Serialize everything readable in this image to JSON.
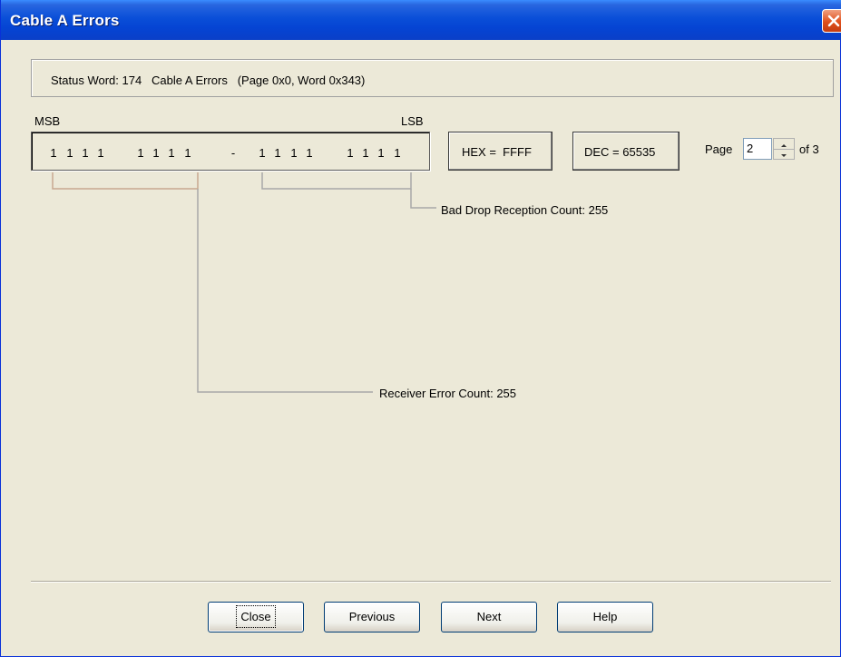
{
  "window": {
    "title": "Cable A Errors"
  },
  "status": {
    "text": "Status Word: 174   Cable A Errors   (Page 0x0, Word 0x343)"
  },
  "bits": {
    "msb_label": "MSB",
    "lsb_label": "LSB",
    "values": [
      "1",
      "1",
      "1",
      "1",
      "1",
      "1",
      "1",
      "1",
      "1",
      "1",
      "1",
      "1",
      "1",
      "1",
      "1",
      "1"
    ],
    "separator": "-"
  },
  "hex": {
    "text": "HEX =  FFFF"
  },
  "dec": {
    "text": "DEC = 65535"
  },
  "page": {
    "label": "Page",
    "value": "2",
    "of_text": "of 3"
  },
  "fields": {
    "bad_drop": "Bad Drop Reception Count: 255",
    "receiver_error": "Receiver Error Count: 255"
  },
  "buttons": {
    "close": "Close",
    "previous": "Previous",
    "next": "Next",
    "help": "Help"
  }
}
